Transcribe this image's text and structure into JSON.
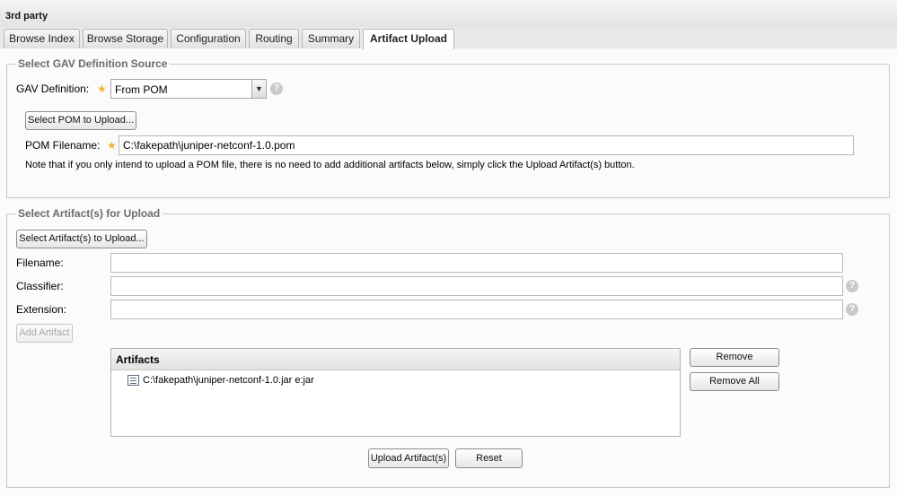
{
  "panel": {
    "title": "3rd party"
  },
  "tabs": [
    {
      "label": "Browse Index",
      "active": false
    },
    {
      "label": "Browse Storage",
      "active": false
    },
    {
      "label": "Configuration",
      "active": false
    },
    {
      "label": "Routing",
      "active": false
    },
    {
      "label": "Summary",
      "active": false
    },
    {
      "label": "Artifact Upload",
      "active": true
    }
  ],
  "gav_section": {
    "legend": "Select GAV Definition Source",
    "gav_label": "GAV Definition:",
    "gav_value": "From POM",
    "select_pom_button": "Select POM to Upload...",
    "pom_filename_label": "POM Filename:",
    "pom_filename_value": "C:\\fakepath\\juniper-netconf-1.0.pom",
    "note": "Note that if you only intend to upload a POM file, there is no need to add additional artifacts below, simply click the Upload Artifact(s) button."
  },
  "artifact_section": {
    "legend": "Select Artifact(s) for Upload",
    "select_artifacts_button": "Select Artifact(s) to Upload...",
    "filename_label": "Filename:",
    "filename_value": "",
    "classifier_label": "Classifier:",
    "classifier_value": "",
    "extension_label": "Extension:",
    "extension_value": "",
    "add_artifact_button": "Add Artifact",
    "grid_header": "Artifacts",
    "artifacts": [
      {
        "text": "C:\\fakepath\\juniper-netconf-1.0.jar e:jar",
        "icon": "file-icon"
      }
    ],
    "remove_button": "Remove",
    "remove_all_button": "Remove All"
  },
  "footer": {
    "upload_button": "Upload Artifact(s)",
    "reset_button": "Reset"
  },
  "colors": {
    "required_star": "#f3b234",
    "legend_text": "#6b6b6b"
  }
}
